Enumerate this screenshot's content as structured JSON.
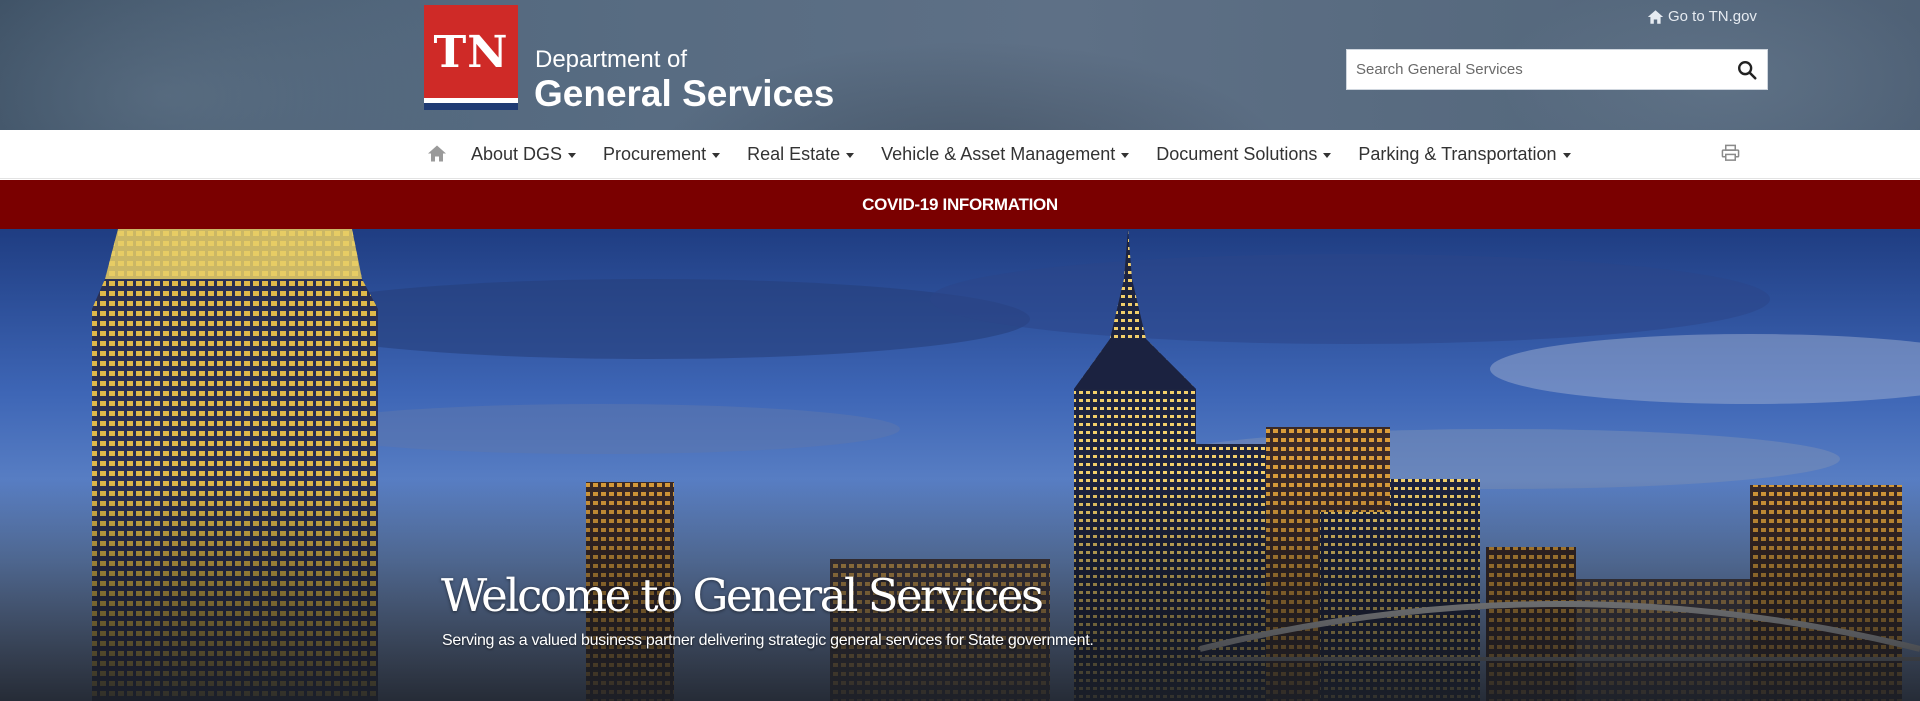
{
  "header": {
    "logo_text": "TN",
    "dept_line1": "Department of",
    "dept_line2": "General Services",
    "goto_link": "Go to TN.gov",
    "search_placeholder": "Search General Services",
    "icons": {
      "home": "home-icon",
      "search": "search-icon",
      "print": "print-icon"
    }
  },
  "nav": {
    "items": [
      {
        "label": "About DGS"
      },
      {
        "label": "Procurement"
      },
      {
        "label": "Real Estate"
      },
      {
        "label": "Vehicle & Asset Management"
      },
      {
        "label": "Document Solutions"
      },
      {
        "label": "Parking & Transportation"
      }
    ]
  },
  "banner": {
    "label": "COVID-19 INFORMATION"
  },
  "hero": {
    "title": "Welcome to General Services",
    "subtitle": "Serving as a valued business partner delivering strategic general services for State government."
  },
  "colors": {
    "tn_red": "#cf2a27",
    "tn_blue": "#1f3b73",
    "header_slate": "#56697e",
    "covid_bar": "#7a0000"
  }
}
